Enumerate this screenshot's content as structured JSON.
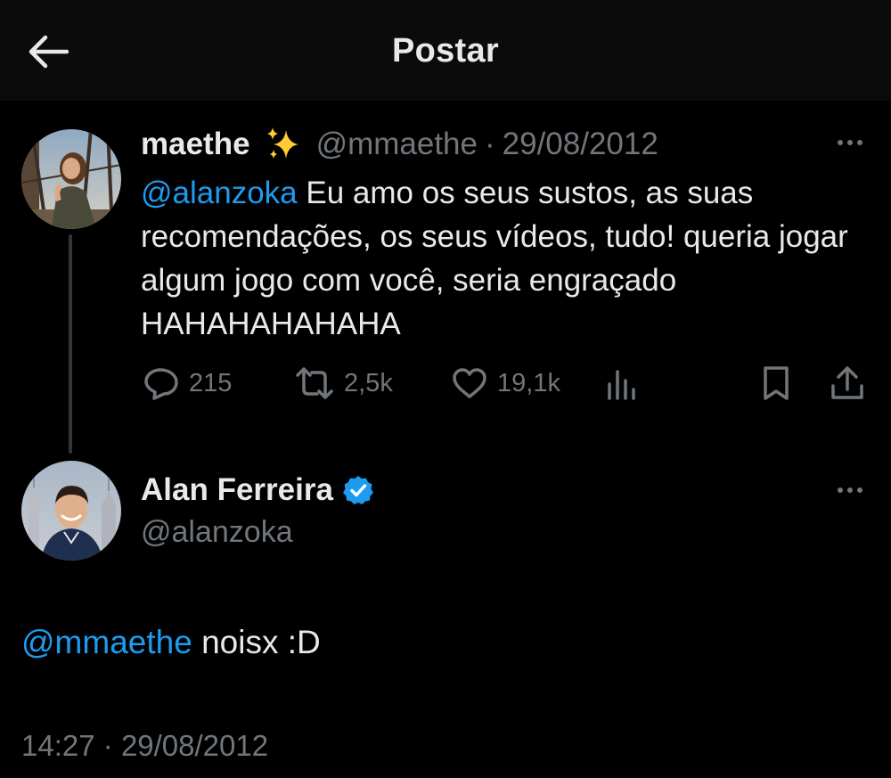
{
  "header": {
    "title": "Postar",
    "back_icon": "arrow-left-icon"
  },
  "original_post": {
    "display_name": "maethe",
    "emoji": "sparkles",
    "handle": "@mmaethe",
    "separator": "·",
    "date": "29/08/2012",
    "mention": "@alanzoka",
    "text": " Eu amo os seus sustos, as suas recomendações, os seus vídeos, tudo! queria jogar algum jogo com você, seria engraçado HAHAHAHAHAHA",
    "stats": {
      "replies": "215",
      "reposts": "2,5k",
      "likes": "19,1k"
    }
  },
  "reply_post": {
    "display_name": "Alan Ferreira",
    "verified": true,
    "handle": "@alanzoka",
    "mention": "@mmaethe",
    "text": " noisx :D",
    "time": "14:27",
    "separator": "·",
    "date": "29/08/2012"
  },
  "colors": {
    "background": "#000000",
    "header_background": "#0b0b0b",
    "text": "#e7e9ea",
    "muted": "#71767b",
    "link": "#1d9bf0"
  }
}
